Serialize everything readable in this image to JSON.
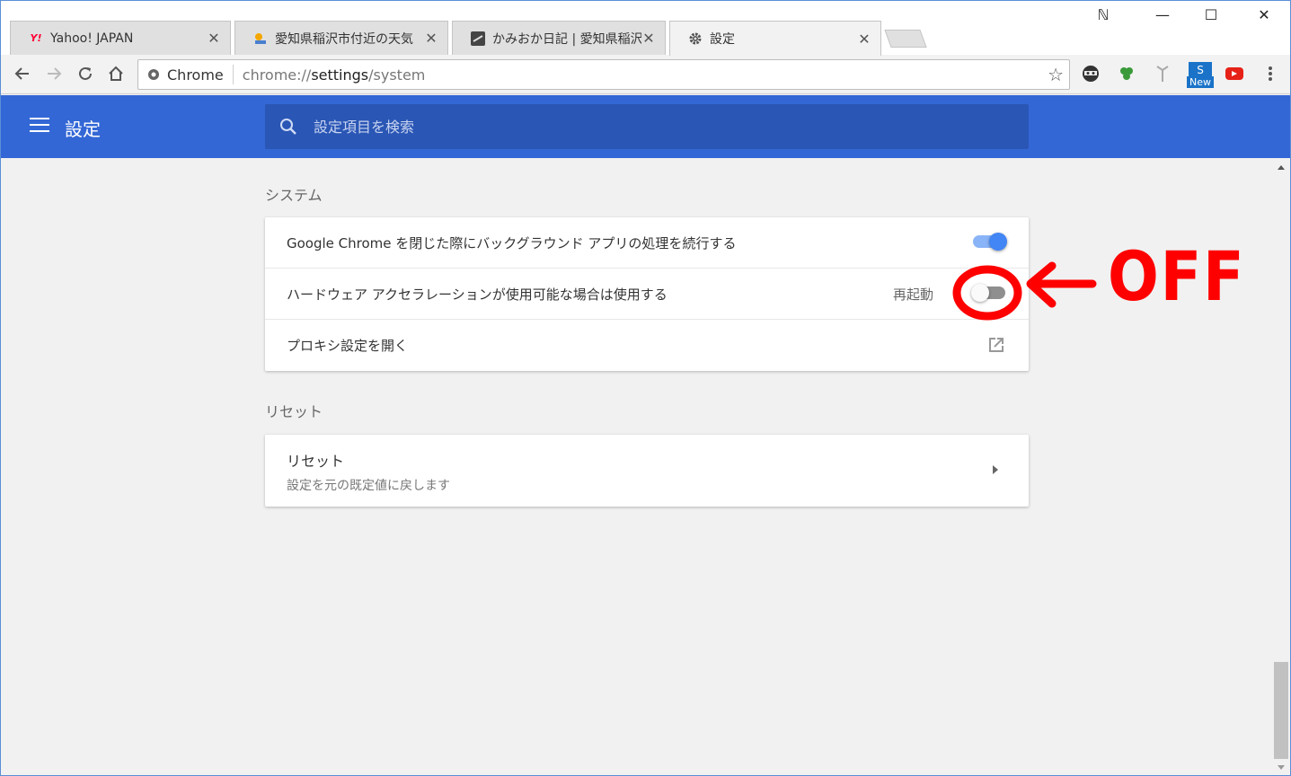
{
  "tabs": [
    {
      "title": "Yahoo! JAPAN",
      "favicon": "yahoo-icon",
      "active": false
    },
    {
      "title": "愛知県稲沢市付近の天気",
      "favicon": "weather-icon",
      "active": false
    },
    {
      "title": "かみおか日記 | 愛知県稲沢",
      "favicon": "blog-icon",
      "active": false
    },
    {
      "title": "設定",
      "favicon": "gear-icon",
      "active": true
    }
  ],
  "window_controls": {
    "profile": "ℕ",
    "minimize": "—",
    "maximize": "☐",
    "close": "✕"
  },
  "toolbar": {
    "chip_label": "Chrome",
    "url_prefix": "chrome://",
    "url_host": "settings",
    "url_path": "/system",
    "extension_new_badge": "New"
  },
  "header": {
    "title": "設定",
    "search_placeholder": "設定項目を検索"
  },
  "sections": {
    "system": {
      "title": "システム",
      "rows": [
        {
          "label": "Google Chrome を閉じた際にバックグラウンド アプリの処理を続行する",
          "toggle": "on"
        },
        {
          "label": "ハードウェア アクセラレーションが使用可能な場合は使用する",
          "restart_label": "再起動",
          "toggle": "off"
        },
        {
          "label": "プロキシ設定を開く",
          "icon": "external-link-icon"
        }
      ]
    },
    "reset": {
      "title": "リセット",
      "row_title": "リセット",
      "row_subtitle": "設定を元の既定値に戻します"
    }
  },
  "annotation": {
    "text": "OFF",
    "color": "#ff0000"
  },
  "colors": {
    "header_blue": "#3367d6",
    "search_blue": "#2a56b5",
    "toggle_on": "#4285f4"
  }
}
